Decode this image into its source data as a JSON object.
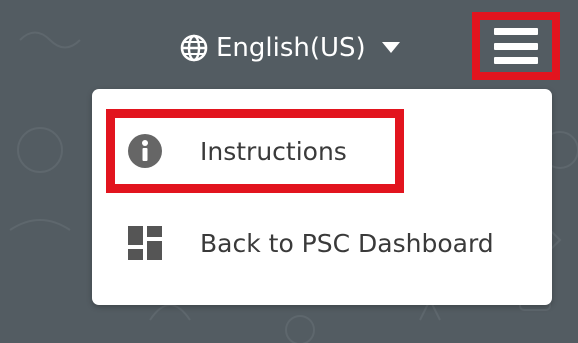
{
  "header": {
    "language_label": "English(US)",
    "language_icon": "globe-icon",
    "language_caret_icon": "caret-down-icon",
    "menu_icon": "hamburger-menu-icon"
  },
  "menu": {
    "items": [
      {
        "label": "Instructions",
        "icon": "info-circle-icon"
      },
      {
        "label": "Back to PSC Dashboard",
        "icon": "dashboard-grid-icon"
      }
    ]
  },
  "colors": {
    "background": "#535c62",
    "highlight": "#e2141e",
    "menu_bg": "#ffffff",
    "menu_text": "#3a3a3a",
    "icon": "#666666"
  }
}
